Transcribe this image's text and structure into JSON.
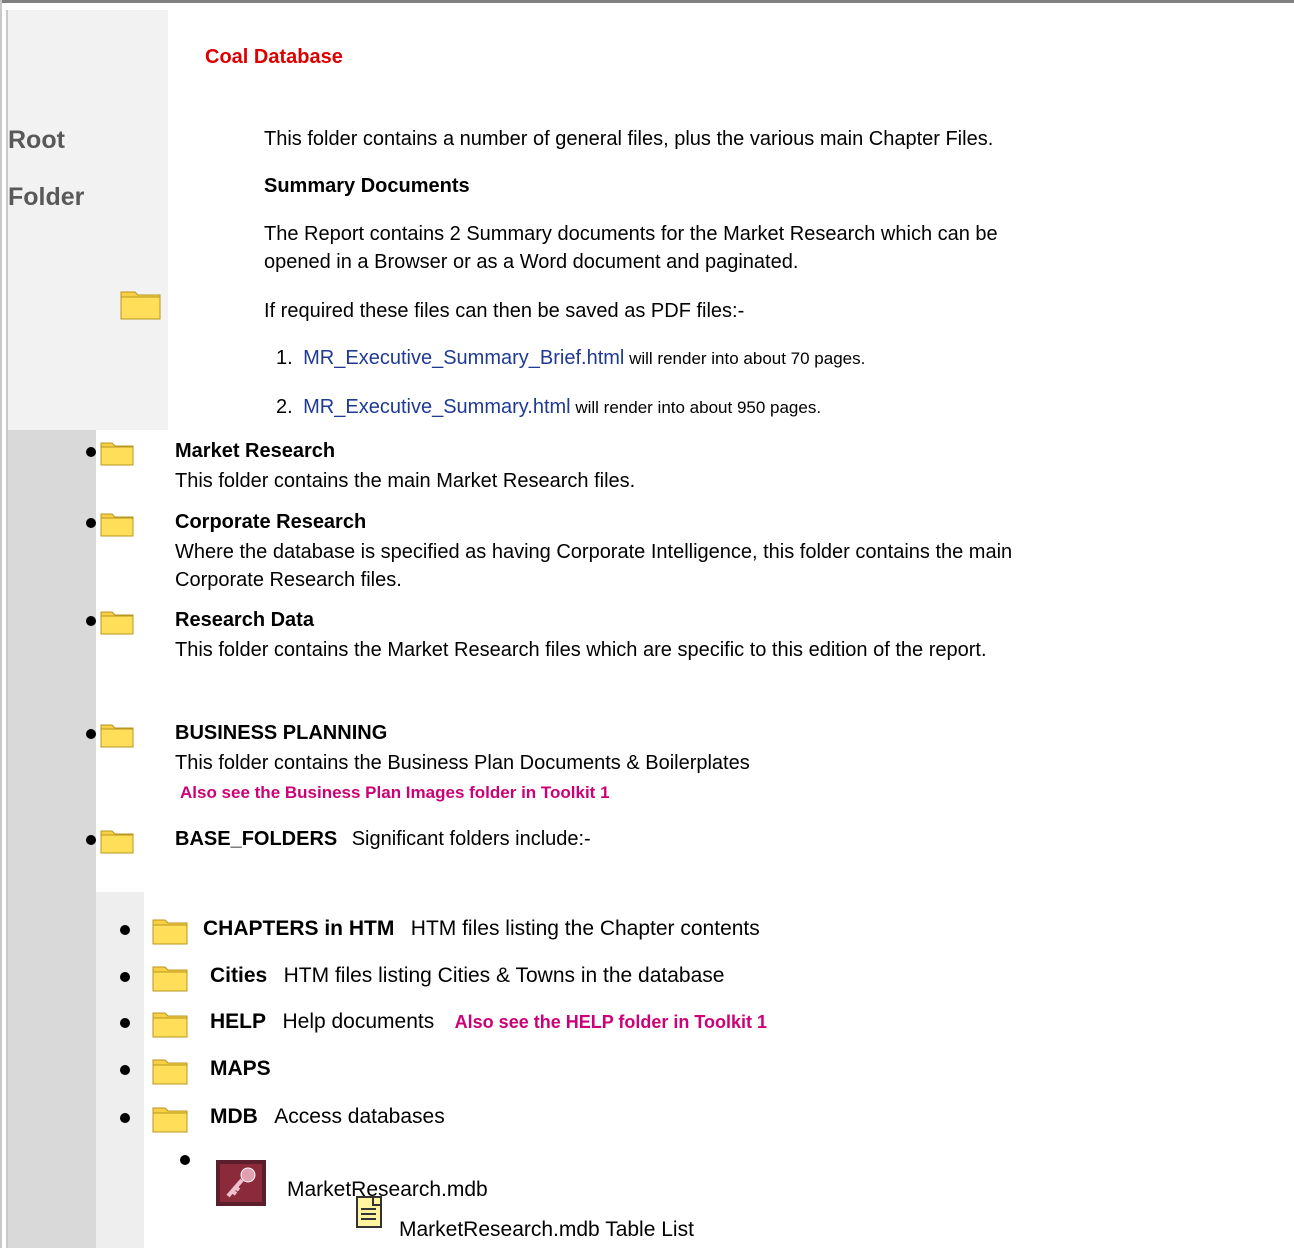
{
  "header": {
    "title": "Coal Database",
    "root_label_line1": "Root",
    "root_label_line2": "Folder"
  },
  "intro": {
    "p1": "This folder contains a number of general files, plus the various main Chapter Files.",
    "summary_heading": "Summary Documents",
    "p2_line1": "The Report contains 2 Summary documents for the Market Research which can be",
    "p2_line2": "opened in a Browser or as a Word document and paginated.",
    "p3": "If required these files can then be saved as PDF files:-",
    "list": [
      {
        "num": "1.",
        "link": "MR_Executive_Summary_Brief.html",
        "rest": " will render into about 70 pages."
      },
      {
        "num": "2.",
        "link": "MR_Executive_Summary.html",
        "rest": " will render into about 950 pages."
      }
    ]
  },
  "folders": [
    {
      "title": "Market Research",
      "desc": "This folder contains the main Market Research files."
    },
    {
      "title": "Corporate Research",
      "desc_line1": "Where the database is specified as having Corporate Intelligence, this folder contains the main",
      "desc_line2": "Corporate Research files."
    },
    {
      "title": "Research Data",
      "desc": "This folder contains the Market Research files which are specific to this edition of the report."
    },
    {
      "title": "BUSINESS PLANNING",
      "desc": "This folder contains the Business Plan Documents & Boilerplates",
      "note": "Also see the Business Plan Images folder in Toolkit 1"
    },
    {
      "title": "BASE_FOLDERS",
      "desc": "Significant folders include:-"
    }
  ],
  "subfolders": [
    {
      "title": "CHAPTERS in HTM",
      "desc": "HTM files listing the Chapter contents"
    },
    {
      "title": "Cities",
      "desc": "HTM files listing Cities & Towns in the database"
    },
    {
      "title": "HELP",
      "desc": "Help documents",
      "note": "Also see the HELP folder in Toolkit 1"
    },
    {
      "title": "MAPS",
      "desc": ""
    },
    {
      "title": "MDB",
      "desc": "Access databases"
    }
  ],
  "mdb": {
    "file": "MarketResearch.mdb",
    "table_list": "MarketResearch.mdb Table List"
  },
  "colors": {
    "title_red": "#dd0000",
    "link_blue": "#1f3a93",
    "note_pink": "#cc0077",
    "folder_yellow": "#f7d046"
  },
  "icons": [
    "folder-icon",
    "access-database-icon",
    "document-icon",
    "bullet"
  ]
}
